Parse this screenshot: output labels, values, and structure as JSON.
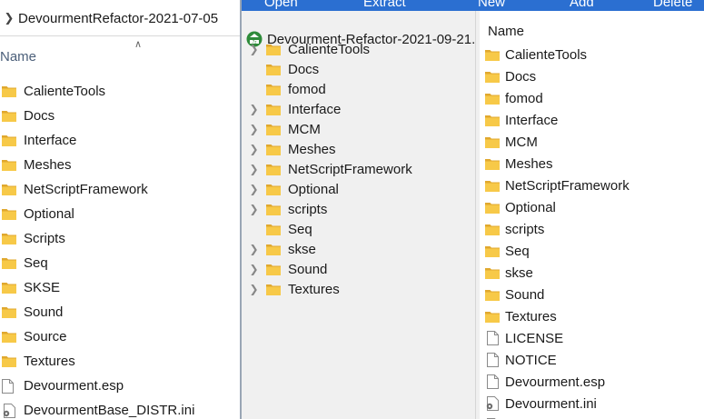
{
  "left_panel": {
    "address": "DevourmentRefactor-2021-07-05",
    "column_header": "Name",
    "items": [
      {
        "label": "CalienteTools",
        "type": "folder"
      },
      {
        "label": "Docs",
        "type": "folder"
      },
      {
        "label": "Interface",
        "type": "folder"
      },
      {
        "label": "Meshes",
        "type": "folder"
      },
      {
        "label": "NetScriptFramework",
        "type": "folder"
      },
      {
        "label": "Optional",
        "type": "folder"
      },
      {
        "label": "Scripts",
        "type": "folder"
      },
      {
        "label": "Seq",
        "type": "folder"
      },
      {
        "label": "SKSE",
        "type": "folder"
      },
      {
        "label": "Sound",
        "type": "folder"
      },
      {
        "label": "Source",
        "type": "folder"
      },
      {
        "label": "Textures",
        "type": "folder"
      },
      {
        "label": "Devourment.esp",
        "type": "file"
      },
      {
        "label": "DevourmentBase_DISTR.ini",
        "type": "ini"
      }
    ]
  },
  "archive": {
    "toolbar": [
      "Open",
      "Extract",
      "New",
      "Add",
      "Delete"
    ],
    "tree_root": "Devourment-Refactor-2021-09-21.",
    "tree_items": [
      {
        "label": "CalienteTools",
        "expandable": true
      },
      {
        "label": "Docs",
        "expandable": false
      },
      {
        "label": "fomod",
        "expandable": false
      },
      {
        "label": "Interface",
        "expandable": true
      },
      {
        "label": "MCM",
        "expandable": true
      },
      {
        "label": "Meshes",
        "expandable": true
      },
      {
        "label": "NetScriptFramework",
        "expandable": true
      },
      {
        "label": "Optional",
        "expandable": true
      },
      {
        "label": "scripts",
        "expandable": true
      },
      {
        "label": "Seq",
        "expandable": false
      },
      {
        "label": "skse",
        "expandable": true
      },
      {
        "label": "Sound",
        "expandable": true
      },
      {
        "label": "Textures",
        "expandable": true
      }
    ],
    "files_header": "Name",
    "files": [
      {
        "label": "CalienteTools",
        "type": "folder"
      },
      {
        "label": "Docs",
        "type": "folder"
      },
      {
        "label": "fomod",
        "type": "folder"
      },
      {
        "label": "Interface",
        "type": "folder"
      },
      {
        "label": "MCM",
        "type": "folder"
      },
      {
        "label": "Meshes",
        "type": "folder"
      },
      {
        "label": "NetScriptFramework",
        "type": "folder"
      },
      {
        "label": "Optional",
        "type": "folder"
      },
      {
        "label": "scripts",
        "type": "folder"
      },
      {
        "label": "Seq",
        "type": "folder"
      },
      {
        "label": "skse",
        "type": "folder"
      },
      {
        "label": "Sound",
        "type": "folder"
      },
      {
        "label": "Textures",
        "type": "folder"
      },
      {
        "label": "LICENSE",
        "type": "file"
      },
      {
        "label": "NOTICE",
        "type": "file"
      },
      {
        "label": "Devourment.esp",
        "type": "file"
      },
      {
        "label": "Devourment.ini",
        "type": "ini"
      },
      {
        "label": "",
        "type": "file"
      }
    ]
  },
  "colors": {
    "toolbar": "#2b6fd1",
    "folder": "#f7c948",
    "header_text": "#4c607a"
  }
}
